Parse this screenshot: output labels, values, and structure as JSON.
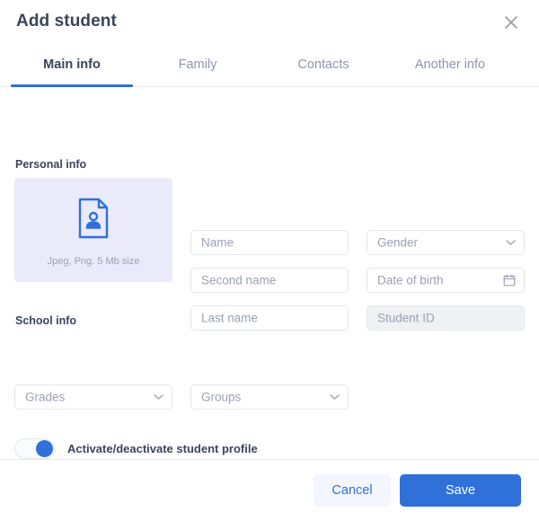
{
  "dialog": {
    "title": "Add student",
    "close_icon": "close-icon"
  },
  "tabs": [
    {
      "label": "Main info",
      "active": true
    },
    {
      "label": "Family",
      "active": false
    },
    {
      "label": "Contacts",
      "active": false
    },
    {
      "label": "Another info",
      "active": false
    }
  ],
  "sections": {
    "personal": {
      "label": "Personal info",
      "photo_upload": {
        "icon": "document-person-icon",
        "hint": "Jpeg, Png. 5 Mb size"
      },
      "fields": {
        "name": {
          "placeholder": "Name",
          "value": ""
        },
        "second_name": {
          "placeholder": "Second name",
          "value": ""
        },
        "last_name": {
          "placeholder": "Last name",
          "value": ""
        },
        "gender": {
          "placeholder": "Gender",
          "value": "",
          "icon": "chevron-down-icon"
        },
        "date_of_birth": {
          "placeholder": "Date of birth",
          "value": "",
          "icon": "calendar-icon"
        },
        "student_id": {
          "placeholder": "Student ID",
          "value": "",
          "disabled": true
        }
      }
    },
    "school": {
      "label": "School info",
      "fields": {
        "grades": {
          "placeholder": "Grades",
          "value": "",
          "icon": "chevron-down-icon"
        },
        "groups": {
          "placeholder": "Groups",
          "value": "",
          "icon": "chevron-down-icon"
        }
      },
      "toggle": {
        "label": "Activate/deactivate student profile",
        "state": "on"
      }
    }
  },
  "footer": {
    "cancel_label": "Cancel",
    "save_label": "Save"
  },
  "colors": {
    "accent": "#2f71d9",
    "text_dark": "#3b4559",
    "text_muted": "#9aa2b4",
    "upload_bg": "#eaeafb",
    "cancel_bg": "#f4f6fd",
    "disabled_bg": "#f0f1f4",
    "border": "#e2e5ea"
  }
}
